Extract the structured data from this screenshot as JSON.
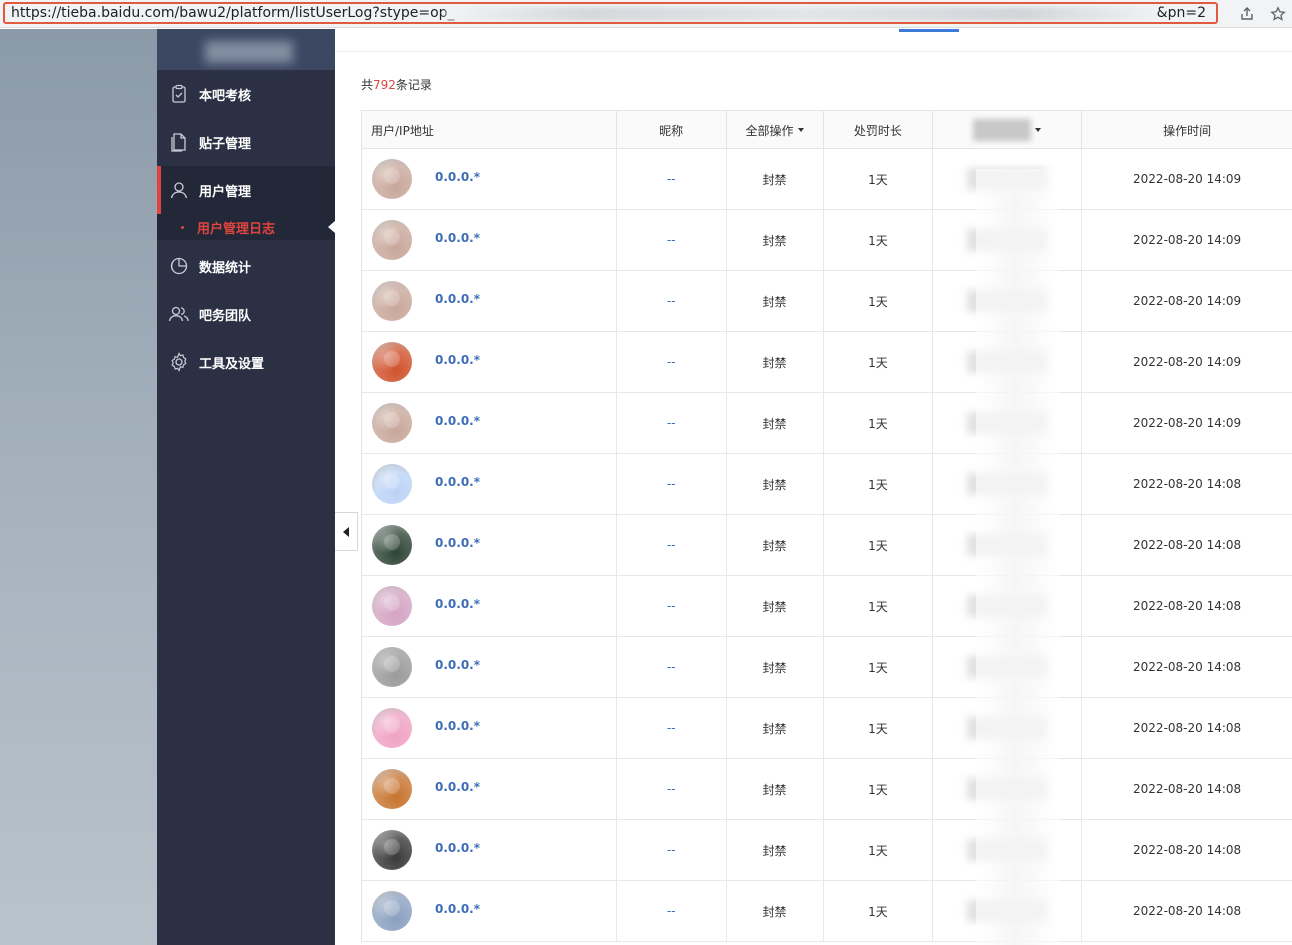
{
  "browser": {
    "url_start": "https://tieba.baidu.com/bawu2/platform/listUserLog?stype=op_",
    "url_end": "&pn=2",
    "share_icon": "share-icon",
    "star_icon": "star-icon"
  },
  "sidebar": {
    "items": [
      {
        "label": "本吧考核",
        "icon": "clipboard-icon"
      },
      {
        "label": "贴子管理",
        "icon": "document-icon"
      },
      {
        "label": "用户管理",
        "icon": "user-icon"
      },
      {
        "label": "数据统计",
        "icon": "pie-chart-icon"
      },
      {
        "label": "吧务团队",
        "icon": "team-icon"
      },
      {
        "label": "工具及设置",
        "icon": "gear-icon"
      }
    ],
    "subitem": {
      "label": "用户管理日志"
    }
  },
  "main": {
    "count_prefix": "共",
    "count_number": "792",
    "count_suffix": "条记录",
    "columns": {
      "user": "用户/IP地址",
      "nick": "昵称",
      "op": "全部操作",
      "duration": "处罚时长",
      "time": "操作时间"
    },
    "rows": [
      {
        "ip": "0.0.0.*",
        "nick": "--",
        "op": "封禁",
        "duration": "1天",
        "time": "2022-08-20 14:09",
        "avatar_color": "#c9a79a"
      },
      {
        "ip": "0.0.0.*",
        "nick": "--",
        "op": "封禁",
        "duration": "1天",
        "time": "2022-08-20 14:09",
        "avatar_color": "#c9a79a"
      },
      {
        "ip": "0.0.0.*",
        "nick": "--",
        "op": "封禁",
        "duration": "1天",
        "time": "2022-08-20 14:09",
        "avatar_color": "#c9a79a"
      },
      {
        "ip": "0.0.0.*",
        "nick": "--",
        "op": "封禁",
        "duration": "1天",
        "time": "2022-08-20 14:09",
        "avatar_color": "#d0532e"
      },
      {
        "ip": "0.0.0.*",
        "nick": "--",
        "op": "封禁",
        "duration": "1天",
        "time": "2022-08-20 14:09",
        "avatar_color": "#c9a79a"
      },
      {
        "ip": "0.0.0.*",
        "nick": "--",
        "op": "封禁",
        "duration": "1天",
        "time": "2022-08-20 14:08",
        "avatar_color": "#bcd3f5"
      },
      {
        "ip": "0.0.0.*",
        "nick": "--",
        "op": "封禁",
        "duration": "1天",
        "time": "2022-08-20 14:08",
        "avatar_color": "#2f4536"
      },
      {
        "ip": "0.0.0.*",
        "nick": "--",
        "op": "封禁",
        "duration": "1天",
        "time": "2022-08-20 14:08",
        "avatar_color": "#d4a4c3"
      },
      {
        "ip": "0.0.0.*",
        "nick": "--",
        "op": "封禁",
        "duration": "1天",
        "time": "2022-08-20 14:08",
        "avatar_color": "#9a9a9a"
      },
      {
        "ip": "0.0.0.*",
        "nick": "--",
        "op": "封禁",
        "duration": "1天",
        "time": "2022-08-20 14:08",
        "avatar_color": "#f0a3c4"
      },
      {
        "ip": "0.0.0.*",
        "nick": "--",
        "op": "封禁",
        "duration": "1天",
        "time": "2022-08-20 14:08",
        "avatar_color": "#c8742f"
      },
      {
        "ip": "0.0.0.*",
        "nick": "--",
        "op": "封禁",
        "duration": "1天",
        "time": "2022-08-20 14:08",
        "avatar_color": "#3a3a3a"
      },
      {
        "ip": "0.0.0.*",
        "nick": "--",
        "op": "封禁",
        "duration": "1天",
        "time": "2022-08-20 14:08",
        "avatar_color": "#8aa0c0"
      }
    ]
  },
  "colors": {
    "sidebar_bg": "#2b3044",
    "accent_red": "#e0443e",
    "link_blue": "#3d6cb8"
  }
}
